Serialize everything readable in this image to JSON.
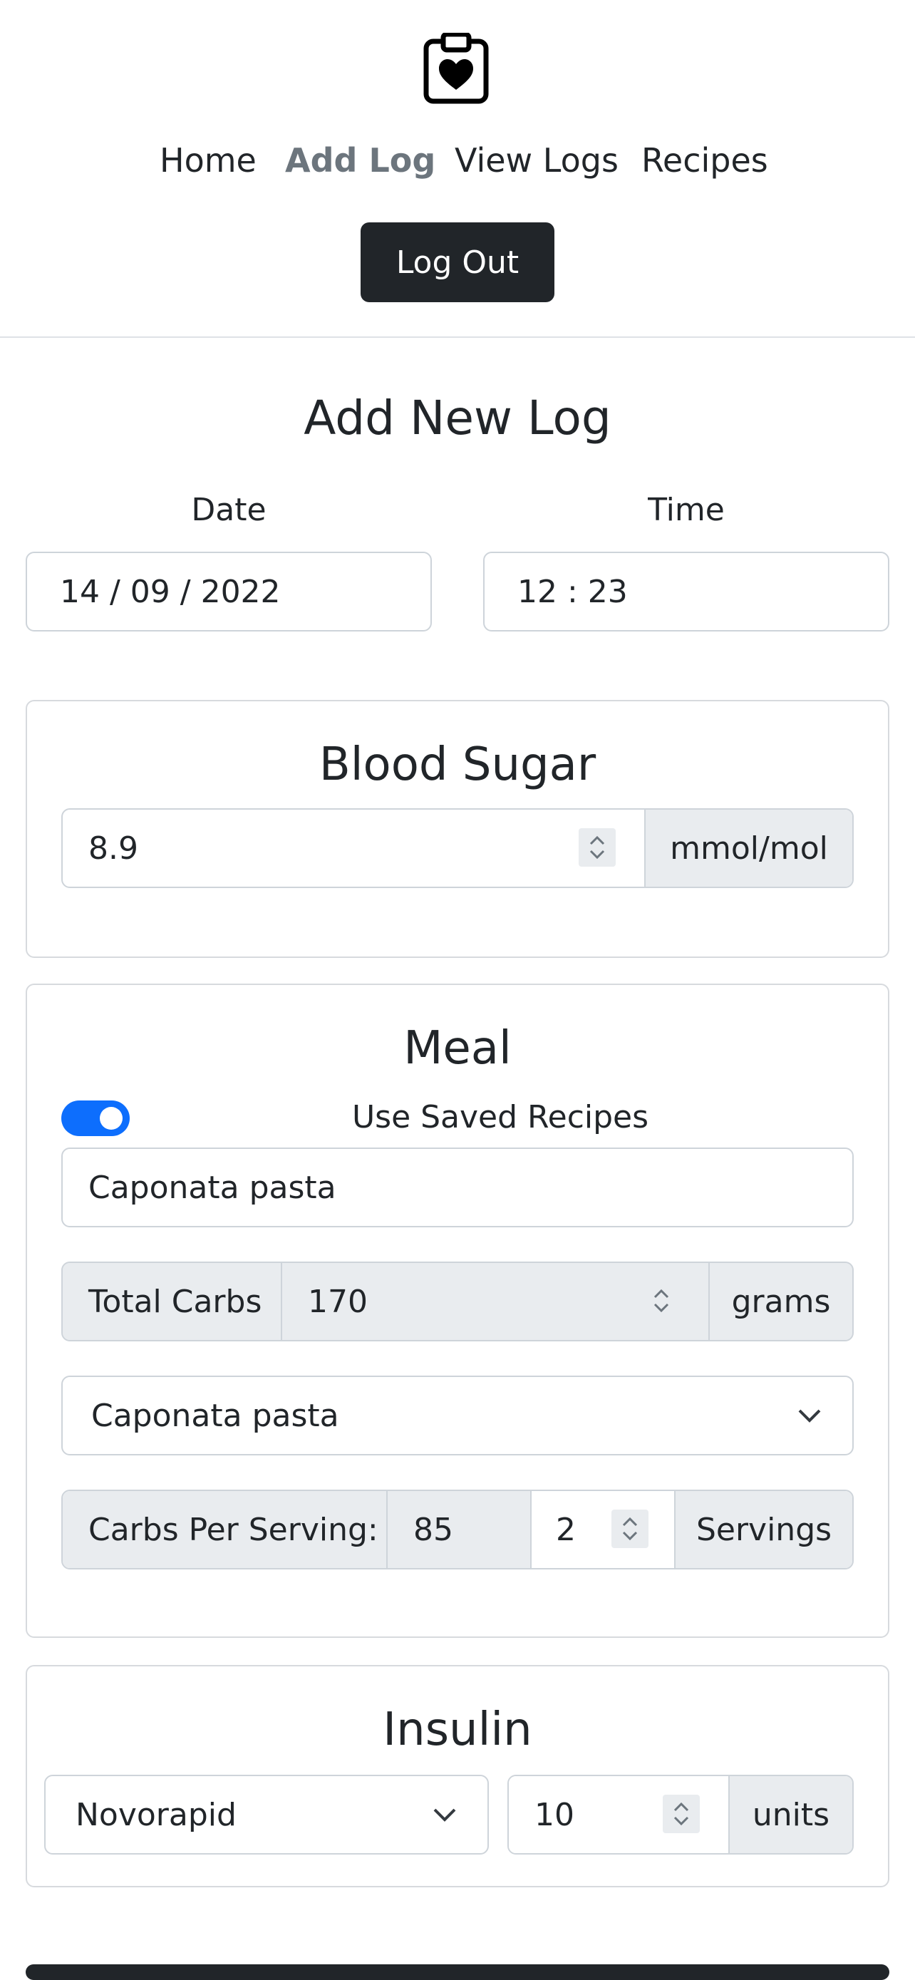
{
  "nav": {
    "items": [
      {
        "label": "Home"
      },
      {
        "label": "Add Log"
      },
      {
        "label": "View Logs"
      },
      {
        "label": "Recipes"
      }
    ],
    "logout_label": "Log Out"
  },
  "page": {
    "title": "Add New Log"
  },
  "datetime": {
    "date_label": "Date",
    "date_value": "14 / 09 / 2022",
    "time_label": "Time",
    "time_value": "12 : 23"
  },
  "blood_sugar": {
    "title": "Blood Sugar",
    "value": "8.9",
    "unit": "mmol/mol"
  },
  "meal": {
    "title": "Meal",
    "toggle_label": "Use Saved Recipes",
    "toggle_on": true,
    "meal_name": "Caponata pasta",
    "total_carbs_label": "Total Carbs",
    "total_carbs_value": "170",
    "total_carbs_unit": "grams",
    "recipe_select": "Caponata pasta",
    "carbs_per_serving_label": "Carbs Per Serving:",
    "carbs_per_serving_value": "85",
    "servings_value": "2",
    "servings_unit": "Servings"
  },
  "insulin": {
    "title": "Insulin",
    "type": "Novorapid",
    "amount": "10",
    "unit": "units"
  },
  "colors": {
    "accent": "#0d6efd",
    "dark": "#212529",
    "muted": "#6c757d",
    "addon_bg": "#e9ecef"
  },
  "icons": {
    "logo": "clipboard-heart-icon",
    "spinner": "spinner-arrows-icon",
    "select": "chevron-down-icon"
  }
}
